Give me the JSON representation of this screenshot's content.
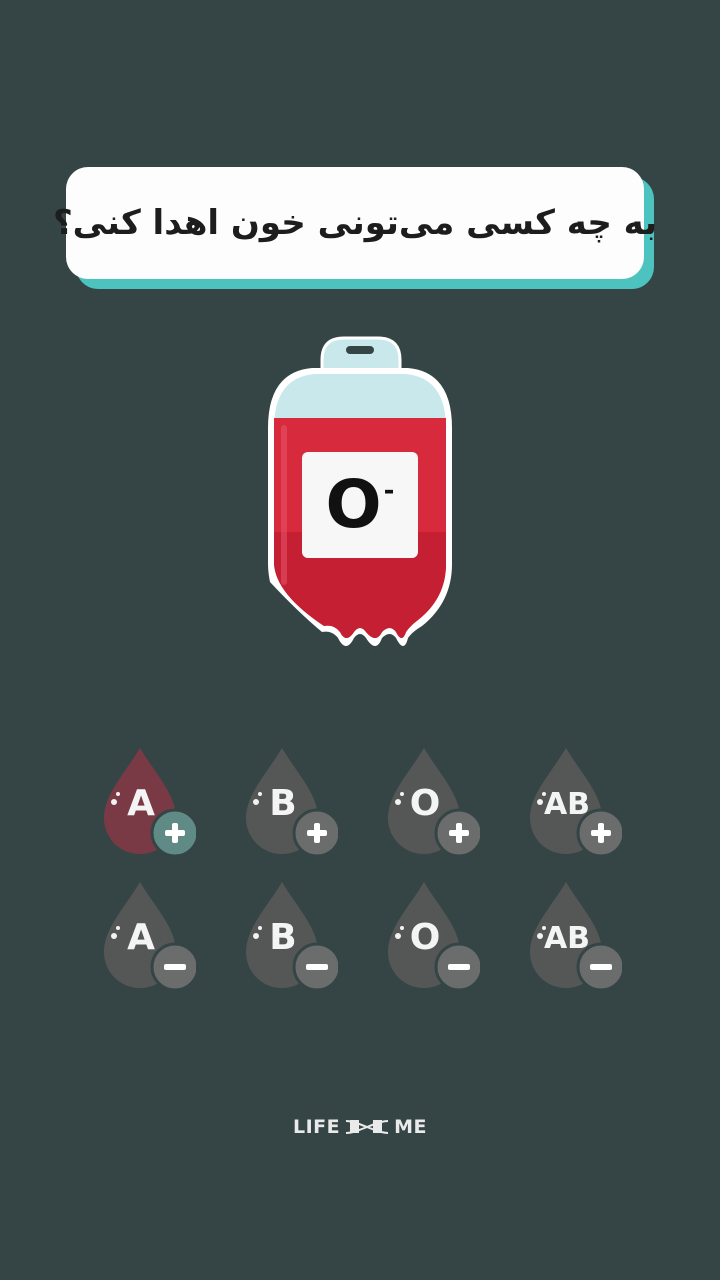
{
  "question": "به چه کسی می‌تونی خون اهدا کنی؟",
  "bag": {
    "type": "O",
    "sign": "-"
  },
  "colors": {
    "background": "#354546",
    "accent": "#4cc3be",
    "blood": "#d72a3d",
    "highlight_drop": "#7a3a45",
    "inactive_drop": "#555757"
  },
  "donors": [
    {
      "type": "A",
      "sign": "+",
      "highlighted": true
    },
    {
      "type": "B",
      "sign": "+",
      "highlighted": false
    },
    {
      "type": "O",
      "sign": "+",
      "highlighted": false
    },
    {
      "type": "AB",
      "sign": "+",
      "highlighted": false
    },
    {
      "type": "A",
      "sign": "-",
      "highlighted": false
    },
    {
      "type": "B",
      "sign": "-",
      "highlighted": false
    },
    {
      "type": "O",
      "sign": "-",
      "highlighted": false
    },
    {
      "type": "AB",
      "sign": "-",
      "highlighted": false
    }
  ],
  "logo": {
    "left": "LIFE",
    "middle": "AND",
    "right": "ME"
  }
}
